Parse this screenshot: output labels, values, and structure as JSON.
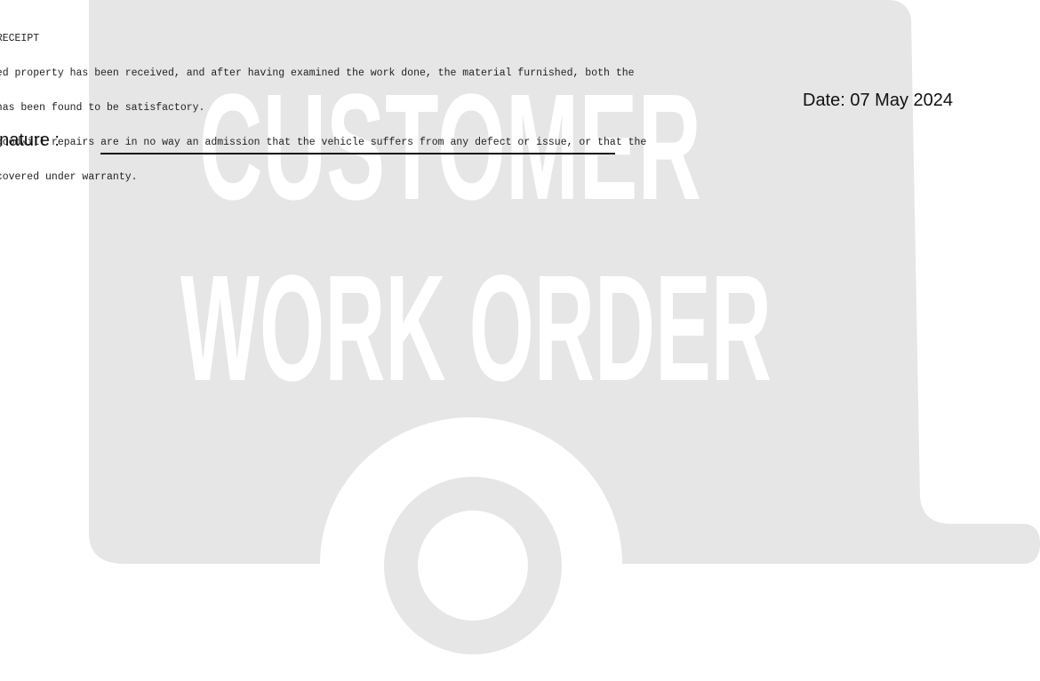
{
  "receipt": {
    "heading": "RECEIPT",
    "lines": [
      "ibed property has been received, and after having examined the work done, the material furnished, both the",
      "l has been found to be satisfactory.",
      "y goodwill repairs are in no way an admission that the vehicle suffers from any defect or issue, or that the",
      "e covered under warranty."
    ]
  },
  "signature": {
    "label": "gnature :"
  },
  "date": {
    "text": "Date: 07 May 2024"
  },
  "watermark": {
    "line1": "CUSTOMER",
    "line2": "WORK ORDER",
    "color": "#e6e6e6",
    "icon": "trailer-icon"
  }
}
